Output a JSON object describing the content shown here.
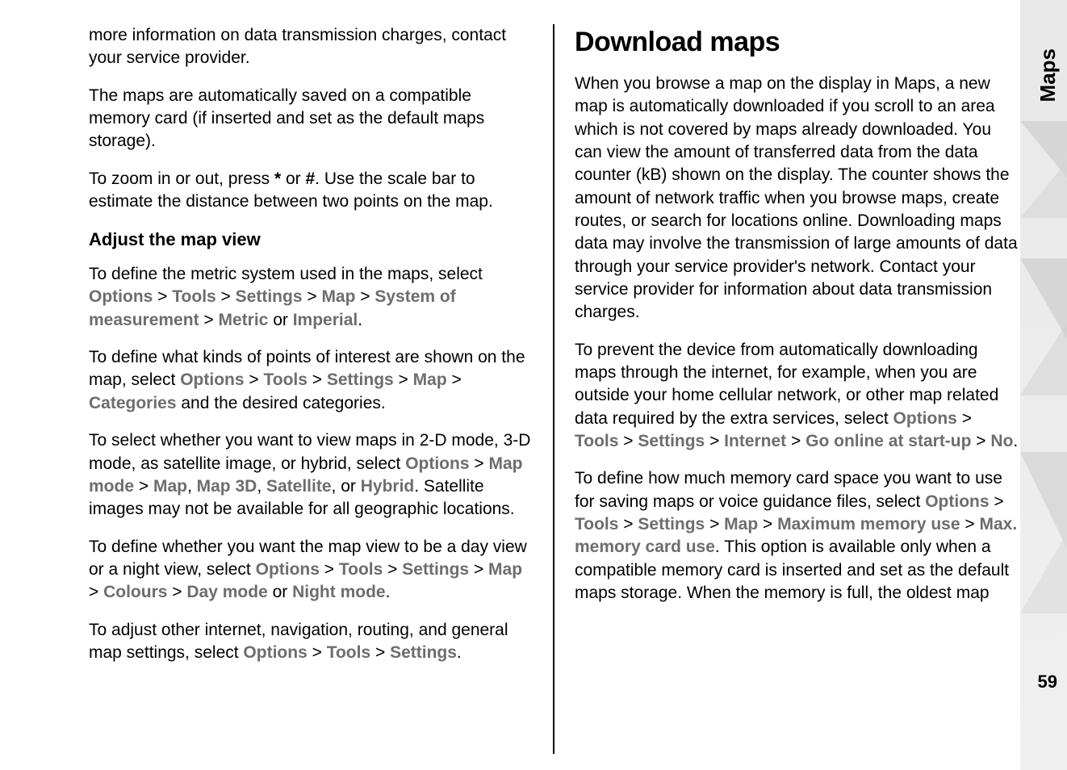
{
  "sideTab": "Maps",
  "pageNumber": "59",
  "left": {
    "p1": "more information on data transmission charges, contact your service provider.",
    "p2": "The maps are automatically saved on a compatible memory card (if inserted and set as the default maps storage).",
    "p3a": "To zoom in or out, press ",
    "p3star": "*",
    "p3b": " or ",
    "p3hash": "#",
    "p3c": ". Use the scale bar to estimate the distance between two points on the map.",
    "h2": "Adjust the map view",
    "p4a": "To define the metric system used in the maps, select ",
    "m_options": "Options",
    "gt": " > ",
    "m_tools": "Tools",
    "m_settings": "Settings",
    "m_map": "Map",
    "m_sys": "System of measurement",
    "m_metric": "Metric",
    "p4or": " or ",
    "m_imperial": "Imperial",
    "period": ".",
    "p5a": "To define what kinds of points of interest are shown on the map, select ",
    "m_categories": "Categories",
    "p5b": " and the desired categories.",
    "p6a": "To select whether you want to view maps in 2-D mode, 3-D mode, as satellite image, or hybrid, select ",
    "m_mapmode": "Map mode",
    "p6comma": ", ",
    "m_map3d": "Map 3D",
    "m_satellite": "Satellite",
    "p6or": ", or ",
    "m_hybrid": "Hybrid",
    "p6b": ". Satellite images may not be available for all geographic locations.",
    "p7a": "To define whether you want the map view to be a day view or a night view, select ",
    "m_colours": "Colours",
    "m_daymode": "Day mode",
    "m_nightmode": "Night mode",
    "p8a": "To adjust other internet, navigation, routing, and general map settings, select "
  },
  "right": {
    "h1": "Download maps",
    "p1": "When you browse a map on the display in Maps, a new map is automatically downloaded if you scroll to an area which is not covered by maps already downloaded. You can view the amount of transferred data from the data counter (kB) shown on the display. The counter shows the amount of network traffic when you browse maps, create routes, or search for locations online. Downloading maps data may involve the transmission of large amounts of data through your service provider's network. Contact your service provider for information about data transmission charges.",
    "p2a": "To prevent the device from automatically downloading maps through the internet, for example, when you are outside your home cellular network, or other map related data required by the extra services, select ",
    "m_internet": "Internet",
    "m_goonline": "Go online at start-up",
    "m_no": "No",
    "p3a": "To define how much memory card space you want to use for saving maps or voice guidance files, select ",
    "m_maxmem": "Maximum memory use",
    "m_maxcard": "Max. memory card use",
    "p3b": ". This option is available only when a compatible memory card is inserted and set as the default maps storage. When the memory is full, the oldest map"
  }
}
